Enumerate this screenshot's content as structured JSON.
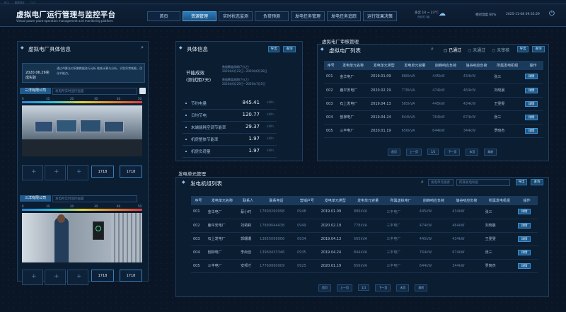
{
  "topbar": {
    "items": [
      "PC1",
      "数据同步",
      "▢ ▢"
    ]
  },
  "header": {
    "title": "虚拟电厂运行管理与监控平台",
    "subtitle": "Virtual power plant operation management and monitoring platform",
    "nav": [
      "首页",
      "资源管理",
      "实时状态监测",
      "负荷预测",
      "发电任务管理",
      "发电任务追踪",
      "运行效果决策"
    ],
    "weather": "多云 14 ~ 23°C",
    "weather_sub": "西北风 3级",
    "humidity": "相对湿度 60%",
    "datetime": "2025-11-08 09:33:29"
  },
  "left": {
    "title": "虚拟电厂具体信息",
    "date": "2020.06.29完成实验",
    "note": "通过AI算法对采集数据进行分析 能耗计算与分析，识别异常耗能，优化节能点。",
    "company1": "三洋有限公司",
    "company2": "三洋有限公司",
    "cam_placeholder": "发电所实时监控画面",
    "scale": [
      "0",
      "10",
      "20",
      "30",
      "40",
      "50"
    ],
    "counters": [
      {
        "value": "1718"
      },
      {
        "value": "1718"
      },
      {
        "value": "1718"
      },
      {
        "value": "1718"
      }
    ]
  },
  "info": {
    "title": "具体信息",
    "btn_export": "导出",
    "btn_query": "查询",
    "period_label": "节能成效 (测试期7天)",
    "ref1": "数据覆盖周期(7分之)",
    "ref1_d": "2020年6月22日—2020年6月28日",
    "ref2": "数据覆盖周期(7分之)",
    "ref2_d": "2020年6月29日—2020年7月5日",
    "metrics": [
      {
        "label": "节约电量",
        "value": "845.41",
        "unit": "kWh"
      },
      {
        "label": "日均节电",
        "value": "120.77",
        "unit": "kWh"
      },
      {
        "label": "末端能耗空调节能率",
        "value": "29.37",
        "unit": "kWh"
      },
      {
        "label": "机房整体节能率",
        "value": "1.97",
        "unit": "kWh"
      },
      {
        "label": "机房负荷量",
        "value": "1.97",
        "unit": "kWh"
      }
    ]
  },
  "audit": {
    "section": "虚拟电厂审核管理",
    "title": "虚拟电厂列表",
    "filters": [
      "已通过",
      "未通过",
      "未审核"
    ],
    "btn_export": "导出",
    "btn_query": "查询",
    "columns": [
      "序号",
      "发电单元名称",
      "发电单元类型",
      "发电单元容量",
      "削峰响应负荷",
      "填谷响应负荷",
      "所属发电机组",
      "操作"
    ],
    "rows": [
      [
        "001",
        "金华电厂",
        "2019.01.09",
        "886kVA",
        "445kW",
        "434kW",
        "张三",
        "详情"
      ],
      [
        "002",
        "鹿平安电厂",
        "2020.02.19",
        "778kVA",
        "474kW",
        "464kW",
        "刘晓晨",
        "详情"
      ],
      [
        "003",
        "石上发电厂",
        "2019.04.13",
        "565kVA",
        "445kW",
        "434kW",
        "王雯雯",
        "详情"
      ],
      [
        "004",
        "刨柳电厂",
        "2019.04.24",
        "844kVA",
        "764kW",
        "674kW",
        "张三",
        "详情"
      ],
      [
        "005",
        "三丰电厂",
        "2020.01.19",
        "656kVA",
        "644kW",
        "344kW",
        "罗晓杰",
        "详情"
      ]
    ],
    "pager": [
      "首页",
      "上一页",
      "1/1",
      "下一页",
      "末页",
      "跳转"
    ]
  },
  "units": {
    "section": "发电单元管理",
    "title": "发电机组列表",
    "search_placeholder1": "发电单元搜索",
    "search_placeholder2": "所属发电机组",
    "btn_export": "导出",
    "btn_query": "查询",
    "columns": [
      "序号",
      "发电单元名称",
      "联系人",
      "联系电话",
      "营销户号",
      "发电单元类型",
      "发电单元容量",
      "所属虚拟电厂",
      "削峰响应负荷",
      "填谷响应负荷",
      "所属发电机组",
      "操作"
    ],
    "rows": [
      [
        "001",
        "金华电厂",
        "蔡小时",
        "17899260098",
        "0948",
        "2019.01.09",
        "886kVA",
        "三丰电厂",
        "445kW",
        "434kW",
        "张三",
        "详情"
      ],
      [
        "002",
        "鹿平安电厂",
        "刘莉莉",
        "17899044438",
        "0949",
        "2020.02.19",
        "778kVA",
        "三丰电厂",
        "474kW",
        "464kW",
        "刘晓晨",
        "详情"
      ],
      [
        "003",
        "石上发电厂",
        "郭珊珊",
        "13855099906",
        "0934",
        "2019.04.13",
        "565kVA",
        "三丰电厂",
        "445kW",
        "434kW",
        "王雯雯",
        "详情"
      ],
      [
        "004",
        "刨柳电厂",
        "李尚佳",
        "13960433346",
        "0935",
        "2019.04.24",
        "844kVA",
        "三丰电厂",
        "764kW",
        "674kW",
        "张三",
        "详情"
      ],
      [
        "005",
        "三丰电厂",
        "安邦才",
        "17769990909",
        "0925",
        "2020.01.19",
        "656kVA",
        "三丰电厂",
        "644kW",
        "344kW",
        "罗晓杰",
        "详情"
      ]
    ],
    "pager": [
      "首页",
      "上一页",
      "1/1",
      "下一页",
      "末页",
      "跳转"
    ]
  }
}
